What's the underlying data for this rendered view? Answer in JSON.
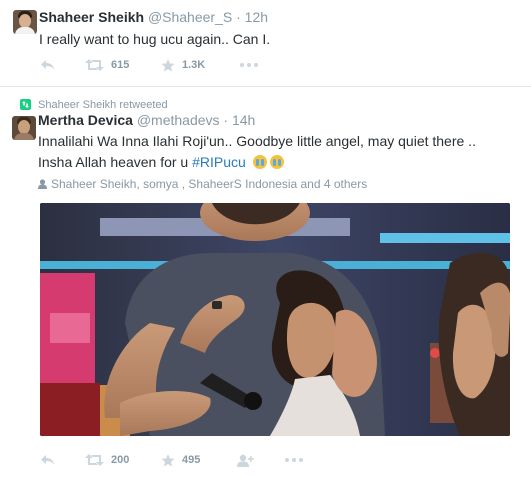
{
  "tweets": [
    {
      "fullname": "Shaheer Sheikh",
      "handle": "@Shaheer_S",
      "separator": "·",
      "time": "12h",
      "text": "I really want to hug ucu again.. Can I.",
      "retweets": "615",
      "favorites": "1.3K"
    },
    {
      "retweeted_by": "Shaheer Sheikh retweeted",
      "fullname": "Mertha Devica",
      "handle": "@methadevs",
      "separator": "·",
      "time": "14h",
      "text_line1": "Innalilahi Wa Inna Ilahi Roji'un.. Goodbye little angel, may quiet there ..",
      "text_line2": "Insha Allah heaven for u ",
      "hashtag": "#RIPucu",
      "context": "Shaheer Sheikh, somya , ShaheerS Indonesia and 4 others",
      "retweets": "200",
      "favorites": "495"
    }
  ],
  "icons": [
    "reply-icon",
    "retweet-icon",
    "favorite-icon",
    "more-icon",
    "follow-icon",
    "person-icon",
    "crying-emoji"
  ],
  "colors": {
    "meta": "#8899a6",
    "text": "#292f33",
    "hashtag": "#2b7bb9",
    "retweet_badge": "#19cf86",
    "divider": "#e1e8ed"
  }
}
